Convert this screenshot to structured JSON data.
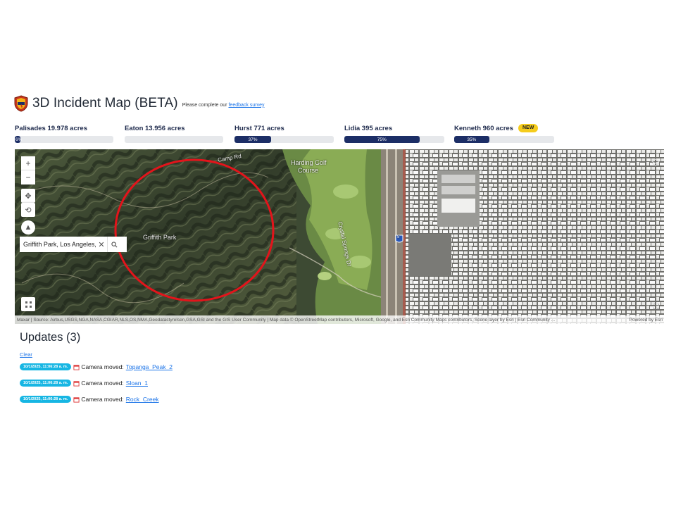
{
  "header": {
    "title": "3D Incident Map (BETA)",
    "survey_prefix": "Please complete our",
    "survey_link": "feedback survey"
  },
  "colors": {
    "accent_navy": "#1c2e66",
    "badge_yellow": "#f5cc1c",
    "timestamp_cyan": "#17b6e3",
    "link_blue": "#1a73e8",
    "fire_circle": "#e3141b"
  },
  "fires": [
    {
      "label": "Palisades 19.978 acres",
      "containment": 6,
      "containment_label": "6%"
    },
    {
      "label": "Eaton 13.956 acres",
      "containment": 0,
      "containment_label": ""
    },
    {
      "label": "Hurst 771 acres",
      "containment": 37,
      "containment_label": "37%"
    },
    {
      "label": "Lidia 395 acres",
      "containment": 75,
      "containment_label": "75%"
    },
    {
      "label": "Kenneth 960 acres",
      "containment": 35,
      "containment_label": "35%",
      "badge": "NEW"
    }
  ],
  "map": {
    "search_value": "Griffith Park, Los Angeles,",
    "icons": {
      "zoom_in": "plus-icon",
      "zoom_out": "minus-icon",
      "pan": "pan-icon",
      "rotate": "rotate-icon",
      "compass": "compass-icon",
      "layers": "layers-icon",
      "fullscreen": "fullscreen-icon",
      "grid": "grid-icon",
      "search": "search-icon",
      "clear": "close-icon"
    },
    "labels": {
      "park": "Griffith Park",
      "golf": "Harding Golf",
      "golf2": "Course",
      "road1": "Camp Rd",
      "road2": "Crystal Springs Dr",
      "highway": "5"
    },
    "attribution": "Maxar | Source: Airbus,USGS,NGA,NASA,CGIAR,NLS,OS,NMA,Geodatastyrelsen,GSA,GSI and the GIS User Community | Map data © OpenStreetMap contributors, Microsoft, Google, and Esri Community Maps contributors, Scene layer by Esri | Esri Community ...",
    "powered": "Powered by Esri"
  },
  "updates": {
    "title": "Updates (3)",
    "clear_label": "Clear",
    "items": [
      {
        "timestamp": "10/1/2025, 11:06:28 a. m.",
        "text": "Camera moved:",
        "link": "Topanga_Peak_2"
      },
      {
        "timestamp": "10/1/2025, 11:06:28 a. m.",
        "text": "Camera moved:",
        "link": "Sloan_1"
      },
      {
        "timestamp": "10/1/2025, 11:06:28 a. m.",
        "text": "Camera moved:",
        "link": "Rock_Creek"
      }
    ]
  }
}
